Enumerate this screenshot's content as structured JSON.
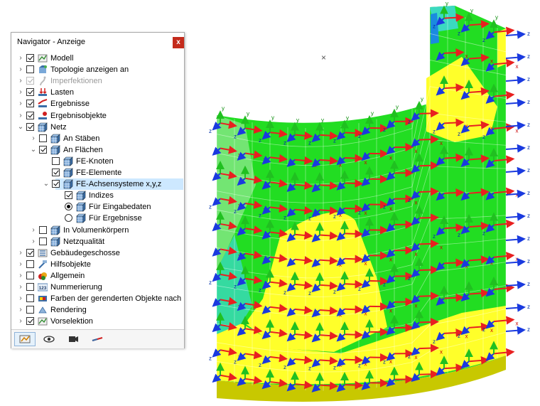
{
  "navigator": {
    "title": "Navigator - Anzeige",
    "close_label": "x",
    "tree": [
      {
        "label": "Modell",
        "depth": 0,
        "expander": "collapsed",
        "control": "checkbox",
        "checked": true,
        "disabled": false,
        "icon": "model-icon"
      },
      {
        "label": "Topologie anzeigen an",
        "depth": 0,
        "expander": "collapsed",
        "control": "checkbox",
        "checked": false,
        "disabled": false,
        "icon": "topology-icon"
      },
      {
        "label": "Imperfektionen",
        "depth": 0,
        "expander": "collapsed",
        "control": "checkbox",
        "checked": true,
        "disabled": true,
        "icon": "imperfection-icon"
      },
      {
        "label": "Lasten",
        "depth": 0,
        "expander": "collapsed",
        "control": "checkbox",
        "checked": true,
        "disabled": false,
        "icon": "load-icon"
      },
      {
        "label": "Ergebnisse",
        "depth": 0,
        "expander": "collapsed",
        "control": "checkbox",
        "checked": true,
        "disabled": false,
        "icon": "results-icon"
      },
      {
        "label": "Ergebnisobjekte",
        "depth": 0,
        "expander": "collapsed",
        "control": "checkbox",
        "checked": true,
        "disabled": false,
        "icon": "result-objects-icon"
      },
      {
        "label": "Netz",
        "depth": 0,
        "expander": "expanded",
        "control": "checkbox",
        "checked": true,
        "disabled": false,
        "icon": "mesh-icon"
      },
      {
        "label": "An Stäben",
        "depth": 1,
        "expander": "collapsed",
        "control": "checkbox",
        "checked": false,
        "disabled": false,
        "icon": "mesh-icon"
      },
      {
        "label": "An Flächen",
        "depth": 1,
        "expander": "expanded",
        "control": "checkbox",
        "checked": true,
        "disabled": false,
        "icon": "mesh-icon"
      },
      {
        "label": "FE-Knoten",
        "depth": 2,
        "expander": "none",
        "control": "checkbox",
        "checked": false,
        "disabled": false,
        "icon": "mesh-icon"
      },
      {
        "label": "FE-Elemente",
        "depth": 2,
        "expander": "none",
        "control": "checkbox",
        "checked": true,
        "disabled": false,
        "icon": "mesh-icon"
      },
      {
        "label": "FE-Achsensysteme x,y,z",
        "depth": 2,
        "expander": "expanded",
        "control": "checkbox",
        "checked": true,
        "disabled": false,
        "icon": "mesh-icon",
        "selected": true
      },
      {
        "label": "Indizes",
        "depth": 3,
        "expander": "none",
        "control": "checkbox",
        "checked": true,
        "disabled": false,
        "icon": "mesh-icon"
      },
      {
        "label": "Für Eingabedaten",
        "depth": 3,
        "expander": "none",
        "control": "radio",
        "checked": true,
        "disabled": false,
        "icon": "mesh-icon"
      },
      {
        "label": "Für Ergebnisse",
        "depth": 3,
        "expander": "none",
        "control": "radio",
        "checked": false,
        "disabled": false,
        "icon": "mesh-icon"
      },
      {
        "label": "In Volumenkörpern",
        "depth": 1,
        "expander": "collapsed",
        "control": "checkbox",
        "checked": false,
        "disabled": false,
        "icon": "mesh-icon"
      },
      {
        "label": "Netzqualität",
        "depth": 1,
        "expander": "collapsed",
        "control": "checkbox",
        "checked": false,
        "disabled": false,
        "icon": "mesh-icon"
      },
      {
        "label": "Gebäudegeschosse",
        "depth": 0,
        "expander": "collapsed",
        "control": "checkbox",
        "checked": true,
        "disabled": false,
        "icon": "floors-icon"
      },
      {
        "label": "Hilfsobjekte",
        "depth": 0,
        "expander": "collapsed",
        "control": "checkbox",
        "checked": false,
        "disabled": false,
        "icon": "guide-objects-icon"
      },
      {
        "label": "Allgemein",
        "depth": 0,
        "expander": "collapsed",
        "control": "checkbox",
        "checked": false,
        "disabled": false,
        "icon": "general-icon"
      },
      {
        "label": "Nummerierung",
        "depth": 0,
        "expander": "collapsed",
        "control": "checkbox",
        "checked": false,
        "disabled": false,
        "icon": "numbering-icon",
        "icon_text": "123"
      },
      {
        "label": "Farben der gerenderten Objekte nach",
        "depth": 0,
        "expander": "collapsed",
        "control": "checkbox",
        "checked": false,
        "disabled": false,
        "icon": "colors-icon"
      },
      {
        "label": "Rendering",
        "depth": 0,
        "expander": "collapsed",
        "control": "checkbox",
        "checked": false,
        "disabled": false,
        "icon": "rendering-icon"
      },
      {
        "label": "Vorselektion",
        "depth": 0,
        "expander": "collapsed",
        "control": "checkbox",
        "checked": true,
        "disabled": false,
        "icon": "preselection-icon"
      }
    ],
    "footer_tabs": [
      {
        "name": "data-tab-icon",
        "active": true
      },
      {
        "name": "view-tab-icon",
        "active": false
      },
      {
        "name": "camera-tab-icon",
        "active": false
      },
      {
        "name": "results-tab-icon",
        "active": false
      }
    ]
  },
  "viewport": {
    "axis_labels": {
      "x": "x",
      "y": "y",
      "z": "z"
    },
    "colors": {
      "green": "#22dd22",
      "yellow": "#ffff2a",
      "base": "#c8c800",
      "x_axis": "#e82020",
      "y_axis": "#20c020",
      "z_axis": "#1a3adf",
      "label_x": "#cc0000",
      "label_y": "#008800",
      "label_z": "#0030aa"
    }
  }
}
